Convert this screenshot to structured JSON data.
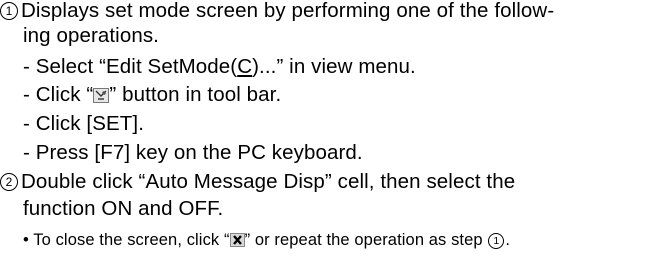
{
  "step1": {
    "number": "1",
    "line1": "Displays set mode screen by performing one of the follow-",
    "line2": "ing operations."
  },
  "operations": {
    "op1_pre": "- Select “Edit SetMode(",
    "op1_key": "C",
    "op1_post": ")...” in view menu.",
    "op2_pre": "- Click “",
    "op2_icon": "set-mode-tool-icon",
    "op2_post": "” button in tool bar.",
    "op3": "- Click [SET].",
    "op4": "- Press [F7] key on the PC keyboard."
  },
  "step2": {
    "number": "2",
    "line1": "Double click “Auto Message Disp” cell, then select the",
    "line2": "function ON and OFF."
  },
  "note": {
    "pre": "• To close the screen, click “",
    "icon": "close-x-icon",
    "mid": "” or repeat the operation as step ",
    "ref_number": "1",
    "post": "."
  }
}
